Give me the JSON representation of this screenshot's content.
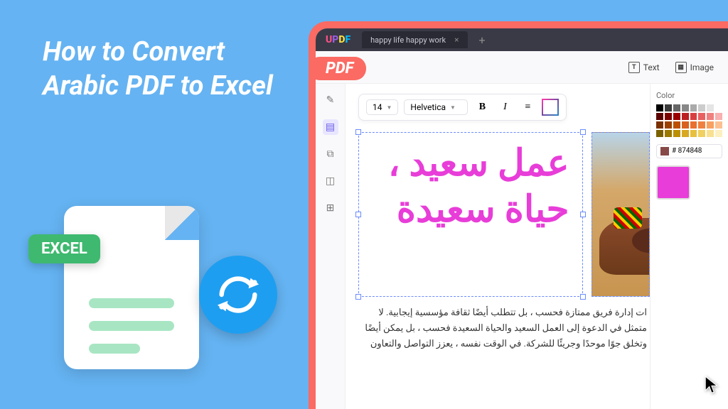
{
  "headline": "How to Convert Arabic PDF to Excel",
  "excel_label": "EXCEL",
  "pdf_label": "PDF",
  "app": {
    "logo": "UPDF",
    "tab_title": "happy life happy work",
    "top_tools": {
      "text": "Text",
      "image": "Image"
    },
    "format": {
      "size": "14",
      "font": "Helvetica"
    },
    "arabic_heading": "عمل سعيد ، حياة سعيدة",
    "paragraph": "ات إدارة فريق ممتازة فحسب ، بل تتطلب أيضًا ثقافة مؤسسية إيجابية. لا متمثل في الدعوة إلى العمل السعيد والحياة السعيدة فحسب ، بل يمكن أيضًا وتخلق جوًا موحدًا وجريئًا للشركة. في الوقت نفسه ، يعزز التواصل والتعاون",
    "color_panel": {
      "title": "Color",
      "hex": "# 874848"
    }
  },
  "swatch_rows": [
    [
      "#000",
      "#3a3a3a",
      "#666",
      "#888",
      "#aaa",
      "#ccc",
      "#e5e5e5",
      "#fff"
    ],
    [
      "#5b0000",
      "#7b0000",
      "#9b0000",
      "#bb2020",
      "#d84040",
      "#e86060",
      "#f08080",
      "#f8b0b0"
    ],
    [
      "#7b3000",
      "#9b4000",
      "#bb5000",
      "#d86020",
      "#e87030",
      "#f08040",
      "#f8a060",
      "#fcc090"
    ],
    [
      "#7b6000",
      "#9b7800",
      "#bb9000",
      "#d8a820",
      "#e8c040",
      "#f0d060",
      "#f8e090",
      "#fcf0c0"
    ]
  ]
}
